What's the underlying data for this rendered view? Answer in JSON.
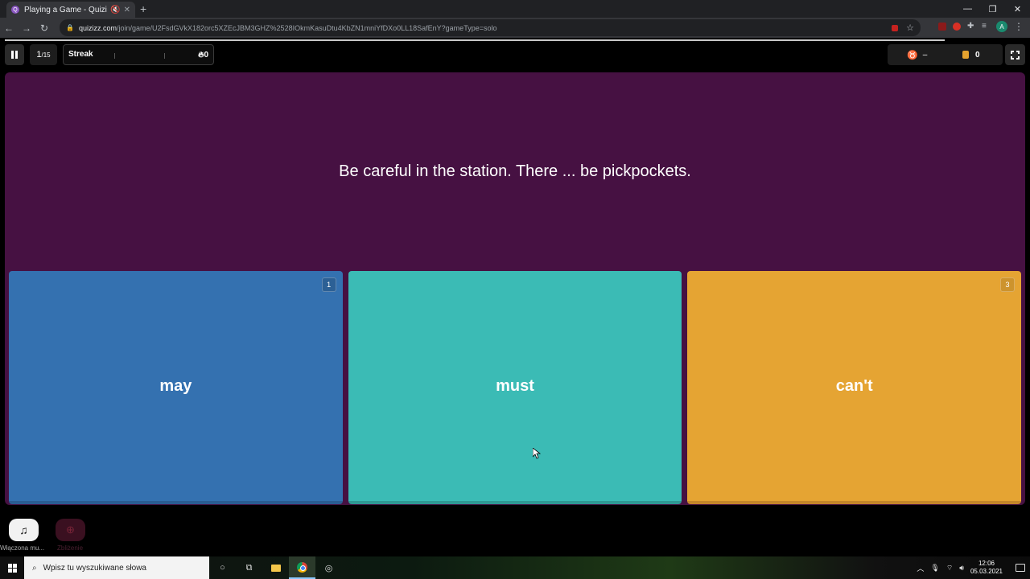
{
  "browser": {
    "tab_title": "Playing a Game - Quizizz",
    "favicon_letter": "Q",
    "url_host": "quizizz.com",
    "url_path": "/join/game/U2FsdGVkX182orc5XZEcJBM3GHZ%2528IOkmKasuDtu4KbZN1mniYfDXo0LL18SafEnY?gameType=solo",
    "profile_initial": "A"
  },
  "game": {
    "question_current": "1",
    "question_total": "/15",
    "streak_label": "Streak",
    "streak_count": "0",
    "powerup_value": "–",
    "coins": "0",
    "question_text": "Be careful in the station. There ... be pickpockets.",
    "options": [
      {
        "label": "may",
        "key": "1",
        "color": "#3471b0"
      },
      {
        "label": "must",
        "key": "2",
        "color": "#3bbbb5"
      },
      {
        "label": "can't",
        "key": "3",
        "color": "#e5a433"
      }
    ],
    "music_label": "Włączona mu...",
    "zoom_label": "Zbliżenie"
  },
  "taskbar": {
    "search_placeholder": "Wpisz tu wyszukiwane słowa",
    "time": "12:06",
    "date": "05.03.2021"
  },
  "colors": {
    "question_bg": "#461142",
    "page_bg": "#000000"
  }
}
